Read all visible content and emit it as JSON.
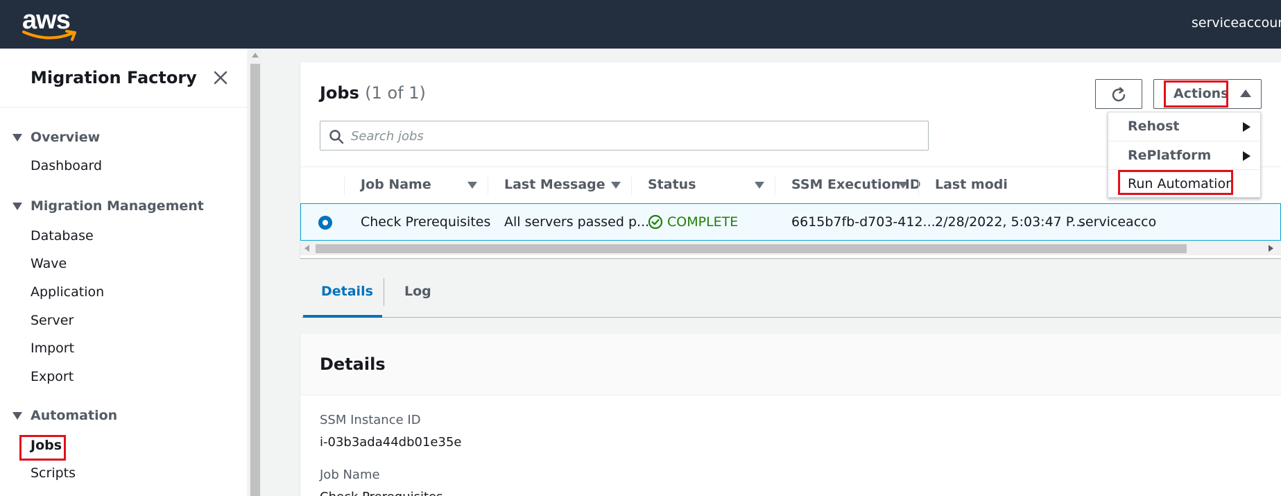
{
  "header": {
    "logo_text": "aws",
    "account": "serviceaccount"
  },
  "sidebar": {
    "title": "Migration Factory",
    "sections": [
      {
        "label": "Overview",
        "items": [
          "Dashboard"
        ]
      },
      {
        "label": "Migration Management",
        "items": [
          "Database",
          "Wave",
          "Application",
          "Server",
          "Import",
          "Export"
        ]
      },
      {
        "label": "Automation",
        "items": [
          "Jobs",
          "Scripts"
        ]
      }
    ],
    "active_item": "Jobs"
  },
  "jobs": {
    "title": "Jobs",
    "count": "(1 of 1)",
    "search_placeholder": "Search jobs",
    "refresh_icon": "refresh-icon",
    "actions_label": "Actions",
    "columns": [
      "Job Name",
      "Last Message",
      "Status",
      "SSM Execution ID",
      "Last modi",
      "odi"
    ],
    "rows": [
      {
        "selected": true,
        "job_name": "Check Prerequisites",
        "last_message": "All servers passed p...",
        "status": "COMPLETE",
        "ssm_execution_id": "6615b7fb-d703-412...",
        "last_modified": "2/28/2022, 5:03:47 P...",
        "modified_by": "serviceacco"
      }
    ]
  },
  "actions_menu": {
    "items": [
      {
        "label": "Rehost",
        "submenu": true
      },
      {
        "label": "RePlatform",
        "submenu": true
      },
      {
        "label": "Run Automation",
        "submenu": false
      }
    ]
  },
  "tabs": [
    {
      "label": "Details",
      "active": true
    },
    {
      "label": "Log",
      "active": false
    }
  ],
  "details": {
    "title": "Details",
    "fields": [
      {
        "label": "SSM Instance ID",
        "value": "i-03b3ada44db01e35e"
      },
      {
        "label": "Job Name",
        "value": "Check Prerequisites"
      }
    ]
  },
  "colors": {
    "topbar": "#232f3e",
    "accent": "#0073bb",
    "success": "#1d8102",
    "highlight": "#e0111a"
  }
}
